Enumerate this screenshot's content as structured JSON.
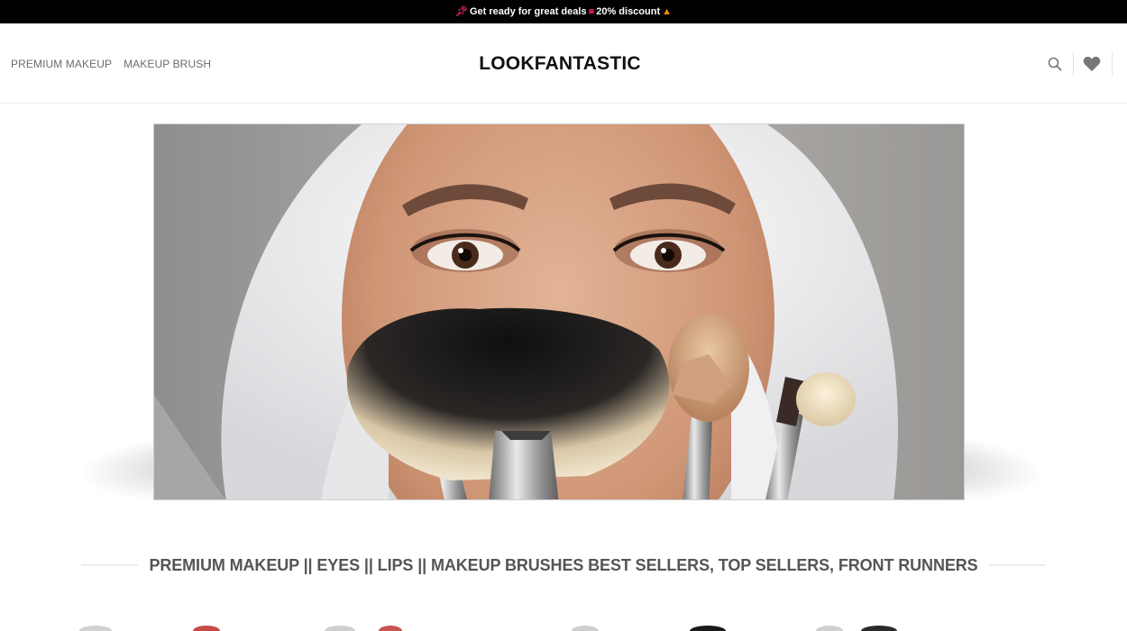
{
  "announcement": {
    "text": "Get ready for great deals",
    "discount": "20% discount",
    "icons": [
      "pin-icon",
      "shopping-bag-icon",
      "fire-icon"
    ]
  },
  "header": {
    "nav": [
      {
        "label": "PREMIUM MAKEUP"
      },
      {
        "label": "MAKEUP BRUSH"
      }
    ],
    "logo": "LOOKFANTASTIC",
    "icons": [
      "search-icon",
      "heart-icon"
    ]
  },
  "hero": {
    "image": "woman-with-towel-holding-makeup-brushes"
  },
  "section": {
    "title": "PREMIUM MAKEUP || EYES || LIPS || MAKEUP BRUSHES BEST SELLERS, TOP SELLERS, FRONT RUNNERS"
  },
  "colors": {
    "topbar_bg": "#000000",
    "text_dark": "#111111",
    "nav_text": "#6b6b6b",
    "section_title": "#555555"
  }
}
